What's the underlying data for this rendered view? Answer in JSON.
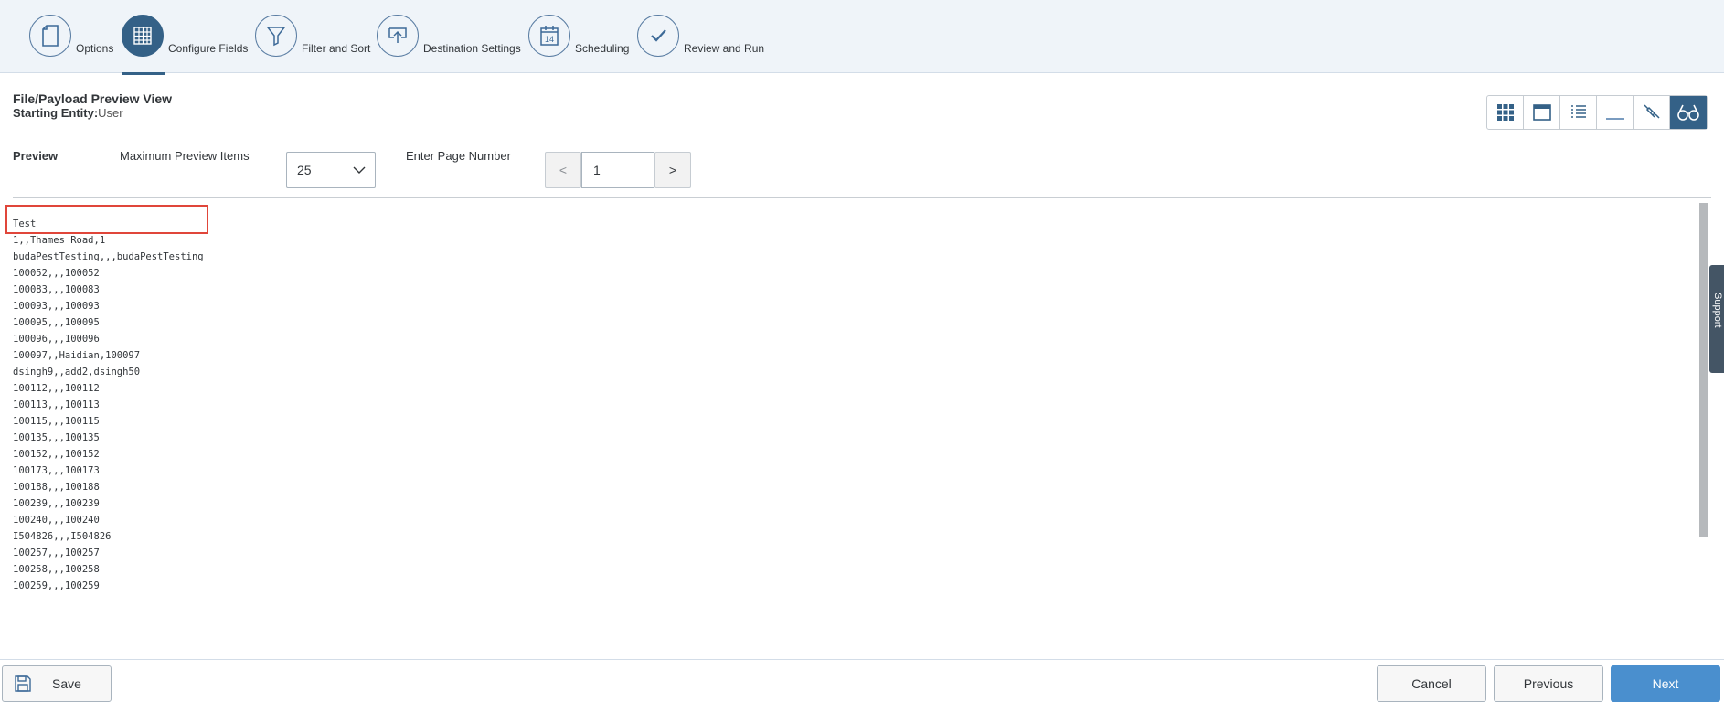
{
  "wizard": {
    "steps": [
      {
        "label": "Options",
        "icon": "document-icon"
      },
      {
        "label": "Configure Fields",
        "icon": "grid-icon"
      },
      {
        "label": "Filter and Sort",
        "icon": "filter-icon"
      },
      {
        "label": "Destination Settings",
        "icon": "upload-icon"
      },
      {
        "label": "Scheduling",
        "icon": "calendar-icon"
      },
      {
        "label": "Review and Run",
        "icon": "checkmark-icon"
      }
    ],
    "active_step": "Configure Fields",
    "calendar_day": "14"
  },
  "header": {
    "title": "File/Payload Preview View",
    "entity_label": "Starting Entity:",
    "entity_value": "User"
  },
  "view_toolbar": [
    "grid-view-icon",
    "form-view-icon",
    "list-view-icon",
    "underline-view-icon",
    "connection-icon",
    "preview-glasses-icon"
  ],
  "preview_controls": {
    "preview_label": "Preview",
    "max_items_label": "Maximum Preview Items",
    "max_items_value": "25",
    "page_number_label": "Enter Page Number",
    "prev_label": "<",
    "page_value": "1",
    "next_label": ">"
  },
  "preview_text": "Test\n1,,Thames Road,1\nbudaPestTesting,,,budaPestTesting\n100052,,,100052\n100083,,,100083\n100093,,,100093\n100095,,,100095\n100096,,,100096\n100097,,Haidian,100097\ndsingh9,,add2,dsingh50\n100112,,,100112\n100113,,,100113\n100115,,,100115\n100135,,,100135\n100152,,,100152\n100173,,,100173\n100188,,,100188\n100239,,,100239\n100240,,,100240\nI504826,,,I504826\n100257,,,100257\n100258,,,100258\n100259,,,100259",
  "support_tab": "Support",
  "footer": {
    "save": "Save",
    "cancel": "Cancel",
    "previous": "Previous",
    "next": "Next"
  },
  "colors": {
    "accent": "#346187",
    "primary_button": "#4a8fce",
    "highlight_box": "#e0463a"
  }
}
